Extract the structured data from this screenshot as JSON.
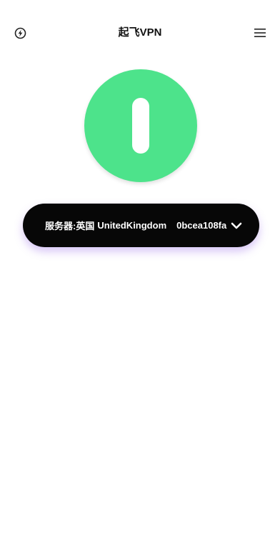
{
  "header": {
    "title": "起飞VPN",
    "left_icon": "power-bolt-icon",
    "right_icon": "menu-icon"
  },
  "power": {
    "color": "#4de38b",
    "icon": "power-toggle-icon"
  },
  "server": {
    "label": "服务器:",
    "country": "英国",
    "name": "UnitedKingdom",
    "id": "0bcea108fa",
    "dropdown_icon": "chevron-down-icon"
  },
  "colors": {
    "accent": "#4de38b",
    "pill": "#070707",
    "pill_glow": "#8c5ae6"
  }
}
